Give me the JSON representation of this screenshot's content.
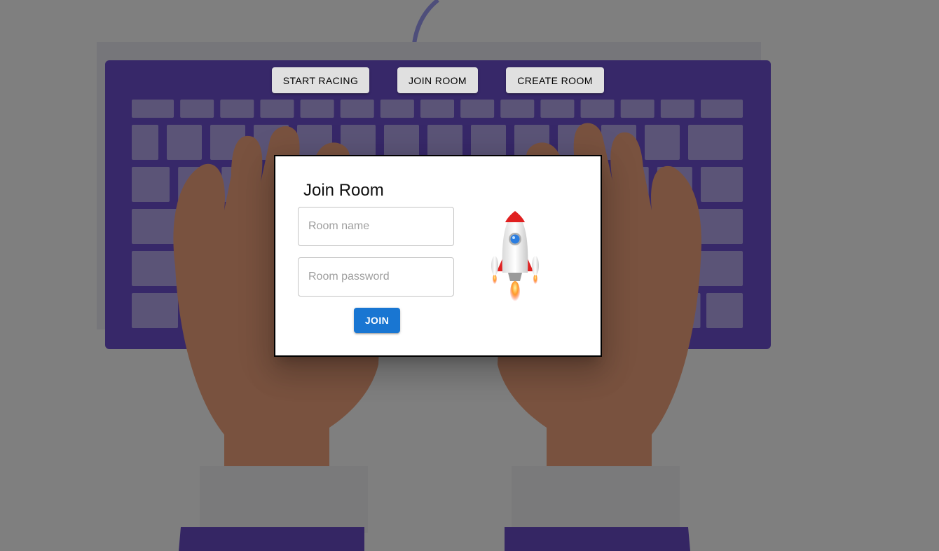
{
  "nav": {
    "start_racing": "START RACING",
    "join_room": "JOIN ROOM",
    "create_room": "CREATE ROOM"
  },
  "dialog": {
    "title": "Join Room",
    "room_name_placeholder": "Room name",
    "room_name_value": "",
    "room_password_placeholder": "Room password",
    "room_password_value": "",
    "join_label": "JOIN"
  },
  "colors": {
    "backdrop_overlay": "#000000",
    "keyboard": "#7b5bd6",
    "keys": "#b8a9f0",
    "hands": "#f4a77f",
    "sleeves": "#6a4cc9",
    "accent": "#1976d2"
  },
  "icons": {
    "illustration": "rocket-icon"
  }
}
